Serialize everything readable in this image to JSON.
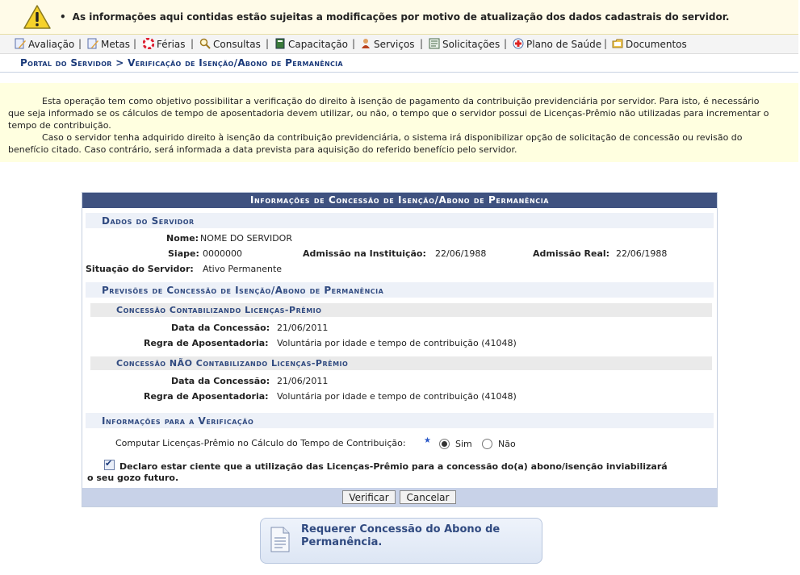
{
  "warning": {
    "message": "As informações aqui contidas estão sujeitas a modificações por motivo de atualização dos dados cadastrais do servidor."
  },
  "menu": [
    {
      "label": "Avaliação",
      "icon": "pencil-doc-icon"
    },
    {
      "label": "Metas",
      "icon": "pencil-doc-icon"
    },
    {
      "label": "Férias",
      "icon": "lifebuoy-icon"
    },
    {
      "label": "Consultas",
      "icon": "magnifier-icon"
    },
    {
      "label": "Capacitação",
      "icon": "book-icon"
    },
    {
      "label": "Serviços",
      "icon": "person-icon"
    },
    {
      "label": "Solicitações",
      "icon": "form-icon"
    },
    {
      "label": "Plano de Saúde",
      "icon": "health-icon"
    },
    {
      "label": "Documentos",
      "icon": "folder-icon"
    }
  ],
  "breadcrumb": "Portal do Servidor > Verificação de Isenção/Abono de Permanência",
  "description": {
    "p1": "Esta operação tem como objetivo possibilitar a verificação do direito à isenção de pagamento da contribuição previdenciária por servidor. Para isto, é necessário que seja informado se os cálculos de tempo de aposentadoria devem utilizar, ou não, o tempo que o servidor possui de Licenças-Prêmio não utilizadas para incrementar o tempo de contribuição.",
    "p2": "Caso o servidor tenha adquirido direito à isenção da contribuição previdenciária, o sistema irá disponibilizar opção de solicitação de concessão ou revisão do benefício citado. Caso contrário, será informada a data prevista para aquisição do referido benefício pelo servidor."
  },
  "form": {
    "caption": "Informações de Concessão de Isenção/Abono de Permanência",
    "servidor": {
      "section": "Dados do Servidor",
      "nome_label": "Nome:",
      "nome": "NOME DO SERVIDOR",
      "siape_label": "Siape:",
      "siape": "0000000",
      "admissao_inst_label": "Admissão na Instituição:",
      "admissao_inst": "22/06/1988",
      "admissao_real_label": "Admissão Real:",
      "admissao_real": "22/06/1988",
      "situacao_label": "Situação do Servidor:",
      "situacao": "Ativo Permanente"
    },
    "previsoes": {
      "section": "Previsões de Concessão de Isenção/Abono de Permanência",
      "com": {
        "title": "Concessão Contabilizando Licenças-Prêmio",
        "data_label": "Data da Concessão:",
        "data": "21/06/2011",
        "regra_label": "Regra de Aposentadoria:",
        "regra": "Voluntária por idade e tempo de contribuição (41048)"
      },
      "sem": {
        "title": "Concessão NÃO Contabilizando Licenças-Prêmio",
        "data_label": "Data da Concessão:",
        "data": "21/06/2011",
        "regra_label": "Regra de Aposentadoria:",
        "regra": "Voluntária por idade e tempo de contribuição (41048)"
      }
    },
    "verificacao": {
      "section": "Informações para a Verificação",
      "question": "Computar Licenças-Prêmio no Cálculo do Tempo de Contribuição:",
      "required_mark": "★",
      "option_yes": "Sim",
      "option_no": "Não",
      "selected": "Sim",
      "declaration_line1": "Declaro estar ciente que a utilização das Licenças-Prêmio para a concessão do(a) abono/isenção inviabilizará",
      "declaration_line2": "o seu gozo futuro.",
      "declaration_checked": true
    },
    "buttons": {
      "verify": "Verificar",
      "cancel": "Cancelar"
    }
  },
  "link_card": {
    "line1": "Requerer Concessão do Abono de",
    "line2": "Permanência."
  }
}
